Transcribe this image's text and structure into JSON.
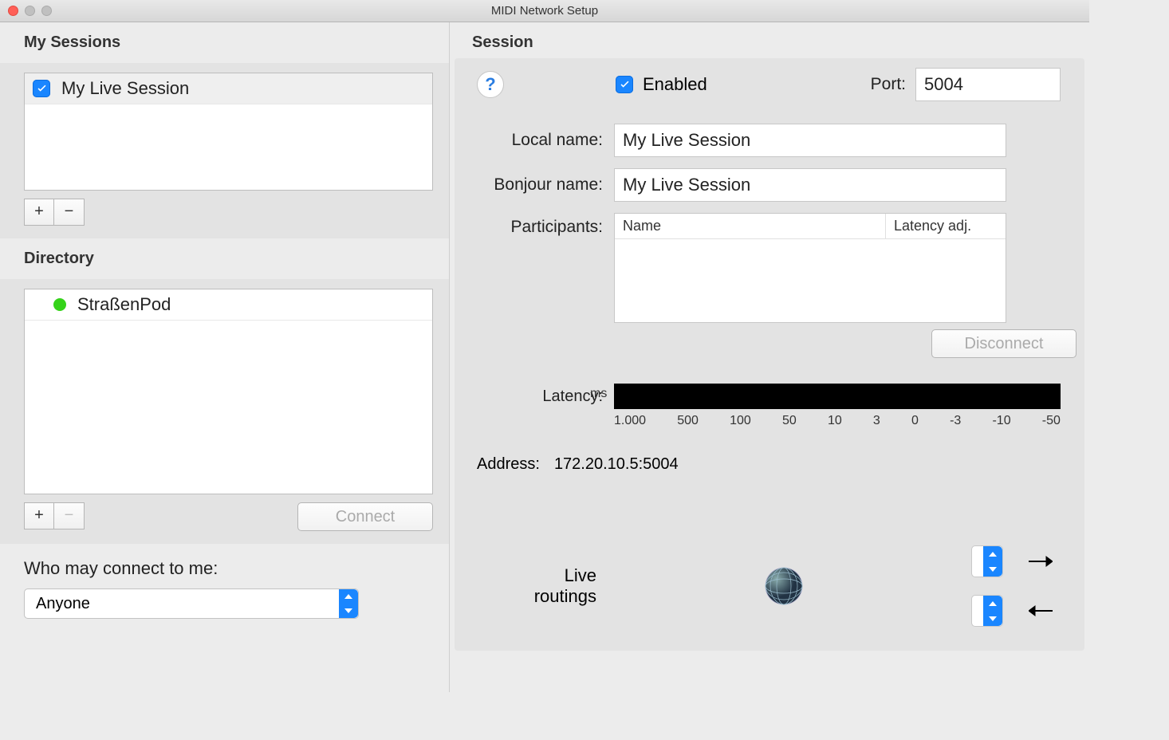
{
  "window": {
    "title": "MIDI Network Setup"
  },
  "left": {
    "sessions_label": "My Sessions",
    "sessions": [
      {
        "checked": true,
        "name": "My Live Session"
      }
    ],
    "directory_label": "Directory",
    "directory": [
      {
        "status": "online",
        "name": "StraßenPod"
      }
    ],
    "connect_label": "Connect",
    "who_label": "Who may connect to me:",
    "who_value": "Anyone"
  },
  "session": {
    "heading": "Session",
    "enabled_label": "Enabled",
    "enabled": true,
    "port_label": "Port:",
    "port_value": "5004",
    "local_name_label": "Local name:",
    "local_name": "My Live Session",
    "bonjour_label": "Bonjour name:",
    "bonjour_name": "My Live Session",
    "participants_label": "Participants:",
    "part_header_name": "Name",
    "part_header_lat": "Latency adj.",
    "disconnect_label": "Disconnect",
    "latency_label": "Latency:",
    "latency_unit": "ms",
    "latency_ticks": [
      "1.000",
      "500",
      "100",
      "50",
      "10",
      "3",
      "0",
      "-3",
      "-10",
      "-50"
    ],
    "address_label": "Address:",
    "address_value": "172.20.10.5:5004",
    "live_label_1": "Live",
    "live_label_2": "routings",
    "route_in": "-",
    "route_out": "-"
  }
}
